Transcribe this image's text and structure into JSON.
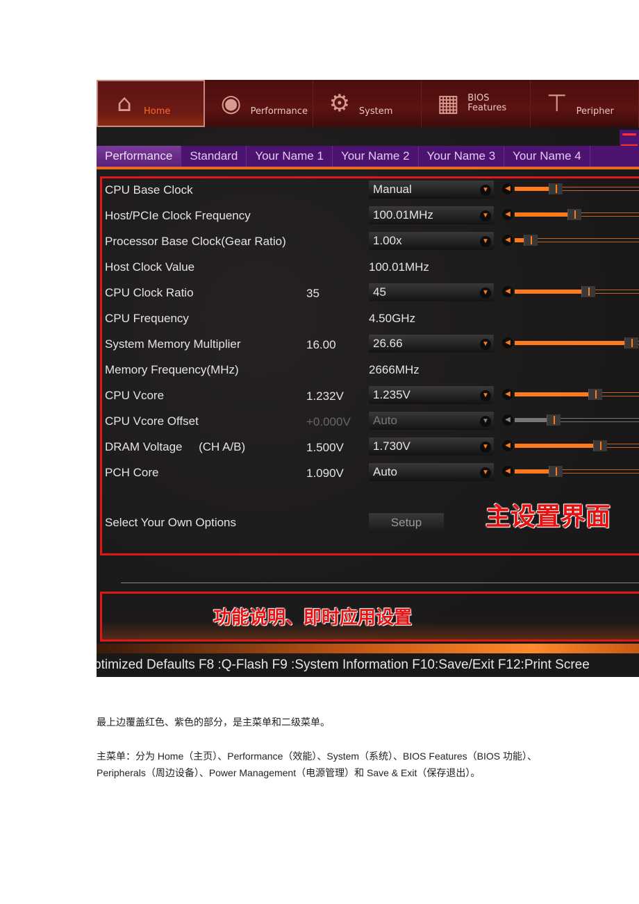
{
  "bios": {
    "main_menu": [
      {
        "label": "Home",
        "icon": "house-icon",
        "active": true
      },
      {
        "label": "Performance",
        "icon": "gauge-icon",
        "active": false
      },
      {
        "label": "System",
        "icon": "gear-icon",
        "active": false
      },
      {
        "label": "BIOS\nFeatures",
        "icon": "chip-icon",
        "active": false
      },
      {
        "label": "Peripher",
        "icon": "plug-icon",
        "active": false
      }
    ],
    "sub_menu": [
      "Performance",
      "Standard",
      "Your Name 1",
      "Your Name 2",
      "Your Name 3",
      "Your Name 4"
    ],
    "sub_menu_marker": "二",
    "settings": [
      {
        "label": "CPU Base Clock",
        "current": "",
        "value": "Manual",
        "type": "dropdown",
        "slider": 0.27
      },
      {
        "label": "Host/PCIe Clock Frequency",
        "current": "",
        "value": "100.01MHz",
        "type": "dropdown",
        "slider": 0.42
      },
      {
        "label": "Processor Base Clock(Gear Ratio)",
        "current": "",
        "value": "1.00x",
        "type": "dropdown",
        "slider": 0.07
      },
      {
        "label": "Host Clock Value",
        "current": "",
        "value": "100.01MHz",
        "type": "text"
      },
      {
        "label": "CPU Clock Ratio",
        "current": "35",
        "value": "45",
        "type": "dropdown",
        "slider": 0.53
      },
      {
        "label": "CPU Frequency",
        "current": "",
        "value": "4.50GHz",
        "type": "text"
      },
      {
        "label": "System Memory Multiplier",
        "current": "16.00",
        "value": "26.66",
        "type": "dropdown",
        "slider": 0.87
      },
      {
        "label": "Memory Frequency(MHz)",
        "current": "",
        "value": "2666MHz",
        "type": "text"
      },
      {
        "label": "CPU Vcore",
        "current": "1.232V",
        "value": "1.235V",
        "type": "dropdown",
        "slider": 0.58
      },
      {
        "label": "CPU Vcore Offset",
        "current": "+0.000V",
        "value": "Auto",
        "type": "dropdown",
        "slider": 0.25,
        "disabled": true
      },
      {
        "label": "DRAM Voltage     (CH A/B)",
        "current": "1.500V",
        "value": "1.730V",
        "type": "dropdown",
        "slider": 0.62
      },
      {
        "label": "PCH Core",
        "current": "1.090V",
        "value": "Auto",
        "type": "dropdown",
        "slider": 0.27
      }
    ],
    "own_options_label": "Select Your Own Options",
    "setup_button": "Setup",
    "annotation_main": "主设置界面",
    "annotation_help": "功能说明、即时应用设置",
    "footer": "ptimized Defaults F8 :Q-Flash F9 :System Information F10:Save/Exit F12:Print Scree",
    "accent": "#ff7a1c",
    "annotation_color": "#e81010"
  },
  "text": {
    "p1": "最上边覆盖红色、紫色的部分，是主菜单和二级菜单。",
    "p2": "主菜单：分为 Home（主页）、Performance（效能）、System（系统）、BIOS Features（BIOS 功能）、Peripherals（周边设备）、Power Management（电源管理）和 Save & Exit（保存退出）。"
  }
}
